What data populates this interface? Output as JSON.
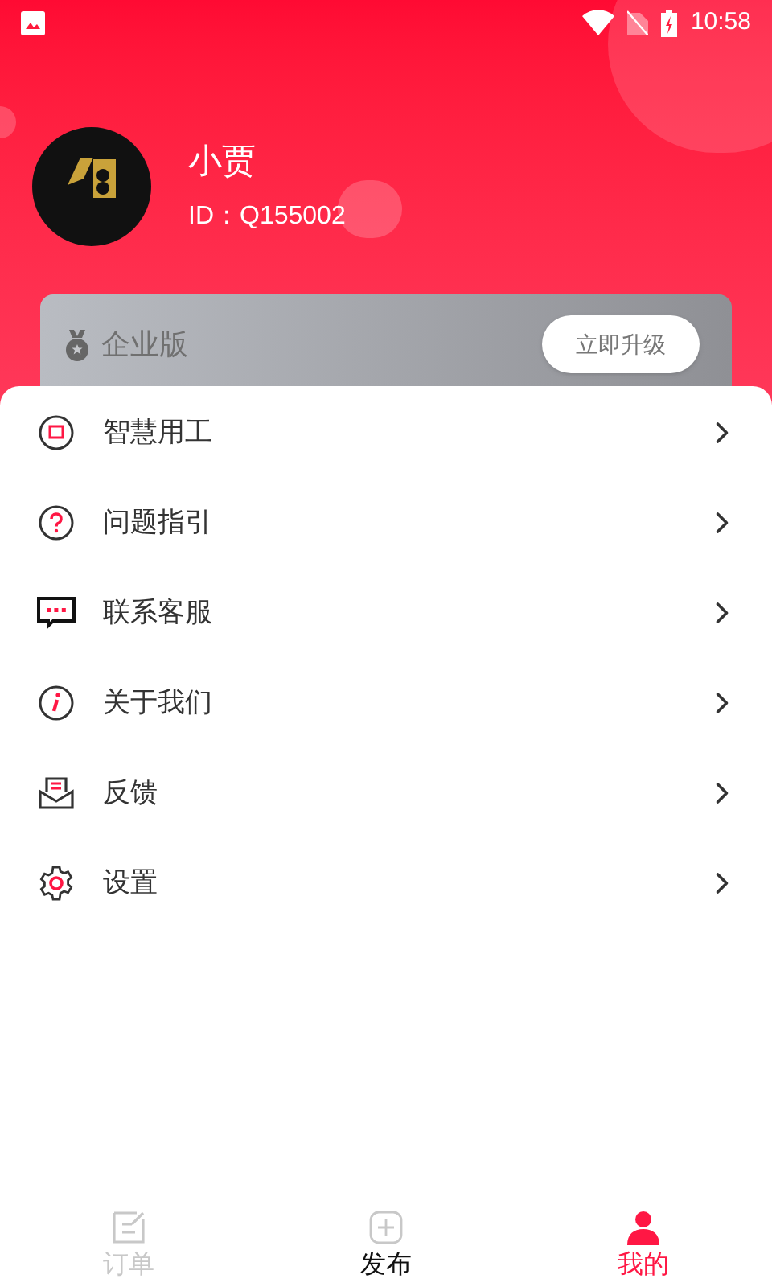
{
  "status_bar": {
    "time": "10:58"
  },
  "profile": {
    "name": "小贾",
    "id": "ID：Q155002"
  },
  "membership": {
    "label": "企业版",
    "button": "立即升级"
  },
  "menu": [
    {
      "label": "智慧用工",
      "kind": "work"
    },
    {
      "label": "问题指引",
      "kind": "help"
    },
    {
      "label": "联系客服",
      "kind": "chat"
    },
    {
      "label": "关于我们",
      "kind": "info"
    },
    {
      "label": "反馈",
      "kind": "feedback"
    },
    {
      "label": "设置",
      "kind": "settings"
    }
  ],
  "bottom_nav": [
    {
      "label": "订单",
      "kind": "orders",
      "selected": false,
      "highlighted": false
    },
    {
      "label": "发布",
      "kind": "publish",
      "selected": false,
      "highlighted": true
    },
    {
      "label": "我的",
      "kind": "me",
      "selected": true,
      "highlighted": false
    }
  ]
}
